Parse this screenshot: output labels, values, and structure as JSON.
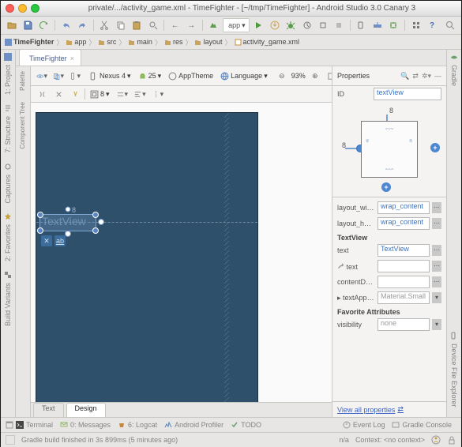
{
  "traffic_colors": {
    "close": "#ff5f57",
    "min": "#febc2e",
    "max": "#28c840"
  },
  "title": "private/.../activity_game.xml - TimeFighter - [~/tmp/TimeFighter] - Android Studio 3.0 Canary 3",
  "run_config": "app",
  "nav": [
    "TimeFighter",
    "app",
    "src",
    "main",
    "res",
    "layout",
    "activity_game.xml"
  ],
  "file_tab": "TimeFighter",
  "palette_tabs": [
    "Palette",
    "Component Tree"
  ],
  "left_tools": [
    {
      "label": "1: Project",
      "icon": "project"
    },
    {
      "label": "7: Structure",
      "icon": "structure"
    },
    {
      "label": "Captures",
      "icon": "captures"
    },
    {
      "label": "2: Favorites",
      "icon": "favorites"
    },
    {
      "label": "Build Variants",
      "icon": "variants"
    }
  ],
  "right_tools": [
    {
      "label": "Gradle",
      "icon": "gradle"
    },
    {
      "label": "Device File Explorer",
      "icon": "device"
    }
  ],
  "designbar": {
    "device": "Nexus 4",
    "api": "25",
    "theme": "AppTheme",
    "lang": "Language",
    "zoom": "93%"
  },
  "margin_default": "8",
  "textview": {
    "label": "TextView",
    "margin_label": "8"
  },
  "props": {
    "header": "Properties",
    "id_label": "ID",
    "id_value": "textView",
    "layout_width_label": "layout_width",
    "layout_width": "wrap_content",
    "layout_height_label": "layout_height",
    "layout_height": "wrap_content",
    "section_tv": "TextView",
    "text_label": "text",
    "text_value": "TextView",
    "tool_text_label": "text",
    "tool_text_value": "",
    "cd_label": "contentDescription",
    "cd_value": "",
    "ta_label": "textAppearance",
    "ta_value": "Material.Small",
    "fav_header": "Favorite Attributes",
    "vis_label": "visibility",
    "vis_value": "none",
    "link": "View all properties",
    "constraint_top": "8",
    "constraint_left": "8"
  },
  "editor_tabs": {
    "text": "Text",
    "design": "Design"
  },
  "bottom_tools": [
    "Terminal",
    "0: Messages",
    "6: Logcat",
    "Android Profiler",
    "TODO"
  ],
  "bottom_right": [
    "Event Log",
    "Gradle Console"
  ],
  "status": {
    "msg": "Gradle build finished in 3s 899ms (5 minutes ago)",
    "loc": "n/a",
    "ctx": "Context: <no context>"
  }
}
